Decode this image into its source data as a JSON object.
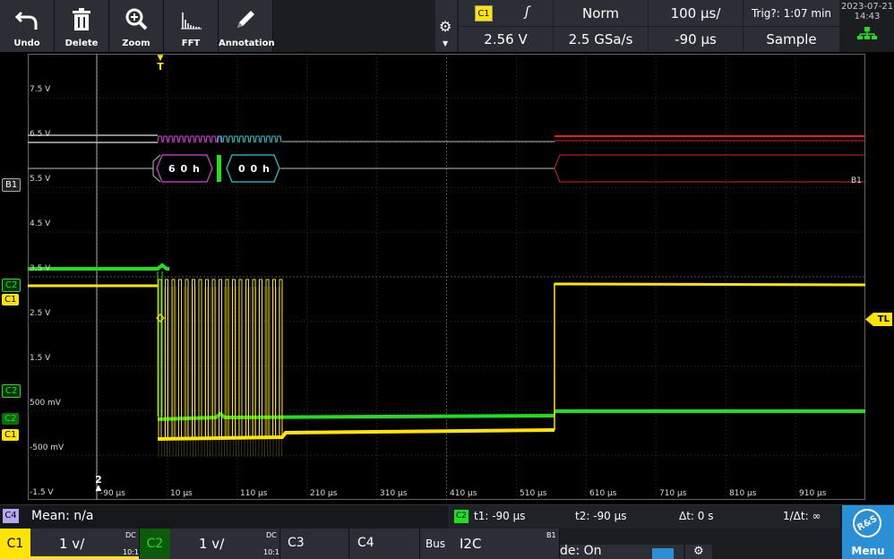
{
  "toolbar": {
    "undo": "Undo",
    "delete": "Delete",
    "zoom": "Zoom",
    "fft": "FFT",
    "annotation": "Annotation"
  },
  "trigger": {
    "source": "C1",
    "level": "2.56 V",
    "mode": "Norm",
    "sample_rate": "2.5 GSa/s",
    "time_scale": "100 µs/",
    "position": "-90 µs",
    "trig_time": "Trig?: 1:07 min",
    "acquisition": "Sample"
  },
  "datetime": {
    "date": "2023-07-21",
    "time": "14:43"
  },
  "volt_labels": [
    "7.5 V",
    "6.5 V",
    "5.5 V",
    "4.5 V",
    "3.5 V",
    "2.5 V",
    "1.5 V",
    "500 mV",
    "-500 mV",
    "-1.5 V"
  ],
  "time_labels": [
    "-90 µs",
    "10 µs",
    "110 µs",
    "210 µs",
    "310 µs",
    "410 µs",
    "510 µs",
    "610 µs",
    "710 µs",
    "810 µs",
    "910 µs"
  ],
  "markers": {
    "trigger": "T",
    "ref": "2",
    "trig_level": "TL",
    "bus": "B1",
    "bus_plot": "B1",
    "c2_top": "C2",
    "c1_top": "C1",
    "c2_low": "C2",
    "c2_low2": "C2",
    "c1_low": "C1"
  },
  "bus_decode": [
    "6 0 h",
    "0 0 h"
  ],
  "measure": {
    "channel": "C4",
    "mean": "Mean: n/a",
    "cursor_channel": "C2",
    "t1": "t1: -90 µs",
    "t2": "t2: -90 µs",
    "dt": "Δt: 0 s",
    "inv_dt": "1/Δt: ∞"
  },
  "bottom": {
    "c1": {
      "name": "C1",
      "scale": "1 v/",
      "coupling": "DC",
      "ratio": "10:1"
    },
    "c2": {
      "name": "C2",
      "scale": "1 v/",
      "coupling": "DC",
      "ratio": "10:1"
    },
    "c3": "C3",
    "c4": "C4",
    "bus": {
      "name": "Bus",
      "protocol": "I2C",
      "id": "B1"
    },
    "partial": "de: On",
    "menu": "Menu",
    "logo": "R&S"
  },
  "colors": {
    "c1": "#ffe400",
    "c2": "#1ee01e",
    "bus_magenta": "#e040e0",
    "bus_cyan": "#20d0d0",
    "accent": "#2b8fd6",
    "error": "#e02020"
  }
}
